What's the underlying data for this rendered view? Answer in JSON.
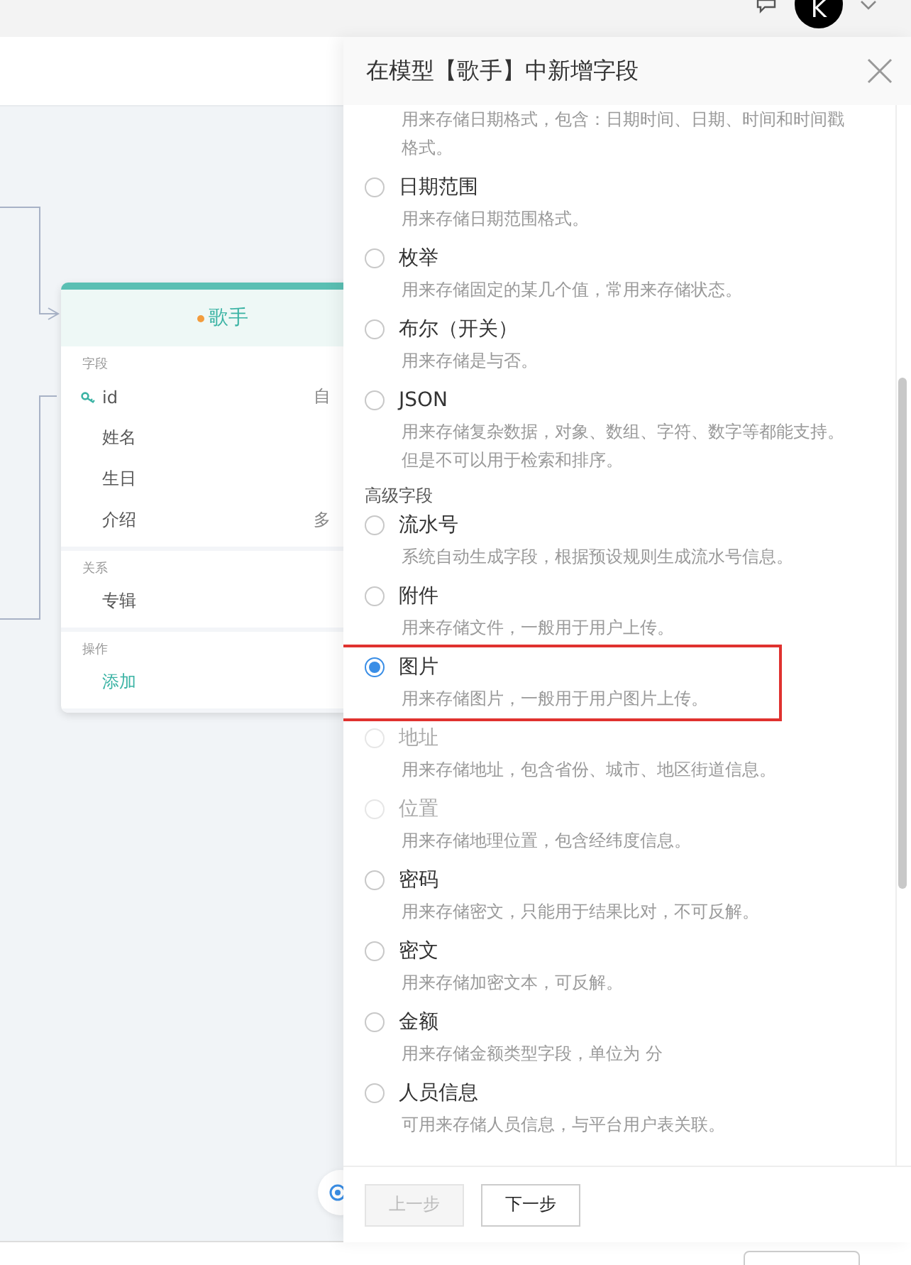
{
  "header": {
    "avatar_letter": "K"
  },
  "model_card": {
    "title": "歌手",
    "sections": [
      {
        "label": "字段",
        "rows": [
          {
            "kind": "key",
            "name": "id",
            "type": "自"
          },
          {
            "kind": "field",
            "name": "姓名"
          },
          {
            "kind": "field",
            "name": "生日"
          },
          {
            "kind": "field",
            "name": "介绍",
            "type": "多"
          }
        ]
      },
      {
        "label": "关系",
        "rows": [
          {
            "kind": "field",
            "name": "专辑"
          }
        ]
      },
      {
        "label": "操作",
        "rows": [
          {
            "kind": "action",
            "name": "添加"
          }
        ]
      }
    ]
  },
  "drawer": {
    "title": "在模型【歌手】中新增字段",
    "groups": [
      {
        "items": [
          {
            "kind": "continued",
            "description": "用来存储日期格式，包含：日期时间、日期、时间和时间戳格式。"
          },
          {
            "kind": "option",
            "title": "日期范围",
            "description": "用来存储日期范围格式。",
            "selected": false,
            "disabled": false
          },
          {
            "kind": "option",
            "title": "枚举",
            "description": "用来存储固定的某几个值，常用来存储状态。",
            "selected": false,
            "disabled": false
          },
          {
            "kind": "option",
            "title": "布尔（开关）",
            "description": "用来存储是与否。",
            "selected": false,
            "disabled": false
          },
          {
            "kind": "option",
            "title": "JSON",
            "description": "用来存储复杂数据，对象、数组、字符、数字等都能支持。但是不可以用于检索和排序。",
            "selected": false,
            "disabled": false
          }
        ]
      },
      {
        "label": "高级字段",
        "items": [
          {
            "kind": "option",
            "title": "流水号",
            "description": "系统自动生成字段，根据预设规则生成流水号信息。",
            "selected": false,
            "disabled": false
          },
          {
            "kind": "option",
            "title": "附件",
            "description": "用来存储文件，一般用于用户上传。",
            "selected": false,
            "disabled": false
          },
          {
            "kind": "option",
            "title": "图片",
            "description": "用来存储图片，一般用于用户图片上传。",
            "selected": true,
            "disabled": false,
            "highlighted": true
          },
          {
            "kind": "option",
            "title": "地址",
            "description": "用来存储地址，包含省份、城市、地区街道信息。",
            "selected": false,
            "disabled": true
          },
          {
            "kind": "option",
            "title": "位置",
            "description": "用来存储地理位置，包含经纬度信息。",
            "selected": false,
            "disabled": true
          },
          {
            "kind": "option",
            "title": "密码",
            "description": "用来存储密文，只能用于结果比对，不可反解。",
            "selected": false,
            "disabled": false
          },
          {
            "kind": "option",
            "title": "密文",
            "description": "用来存储加密文本，可反解。",
            "selected": false,
            "disabled": false
          },
          {
            "kind": "option",
            "title": "金额",
            "description": "用来存储金额类型字段，单位为 分",
            "selected": false,
            "disabled": false
          },
          {
            "kind": "option",
            "title": "人员信息",
            "description": "可用来存储人员信息，与平台用户表关联。",
            "selected": false,
            "disabled": false
          }
        ]
      }
    ],
    "buttons": [
      {
        "label": "上一步",
        "disabled": true
      },
      {
        "label": "下一步",
        "disabled": false
      }
    ]
  }
}
